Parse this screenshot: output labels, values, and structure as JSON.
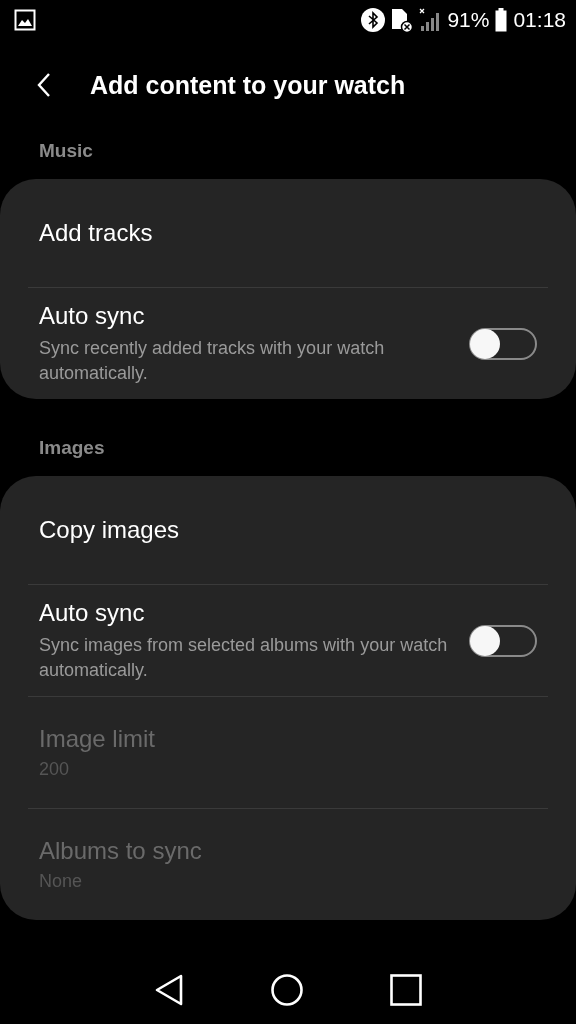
{
  "status_bar": {
    "battery_percent": "91%",
    "time": "01:18"
  },
  "app_bar": {
    "title": "Add content to your watch"
  },
  "sections": [
    {
      "header": "Music",
      "items": [
        {
          "kind": "link",
          "title": "Add tracks"
        },
        {
          "kind": "switch",
          "title": "Auto sync",
          "summary": "Sync recently added tracks with your watch automatically.",
          "on": false
        }
      ]
    },
    {
      "header": "Images",
      "items": [
        {
          "kind": "link",
          "title": "Copy images"
        },
        {
          "kind": "switch",
          "title": "Auto sync",
          "summary": "Sync images from selected albums with your watch automatically.",
          "on": false
        },
        {
          "kind": "value",
          "title": "Image limit",
          "value": "200",
          "disabled": true
        },
        {
          "kind": "value",
          "title": "Albums to sync",
          "value": "None",
          "disabled": true
        }
      ]
    }
  ]
}
